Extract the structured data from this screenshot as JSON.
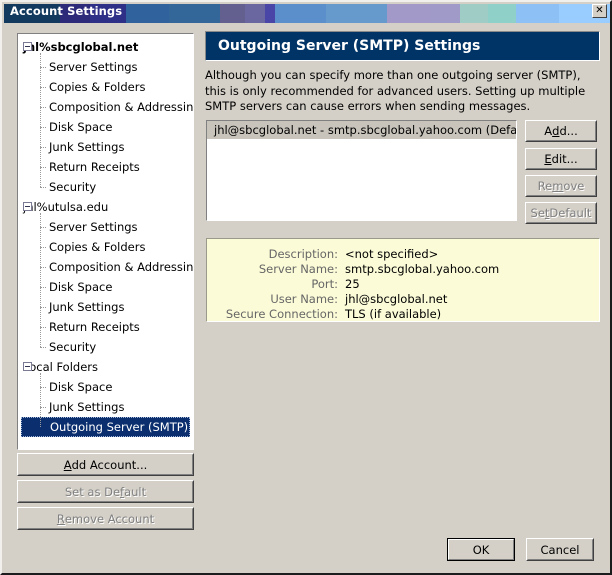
{
  "window": {
    "title": "Account Settings",
    "close_icon": "close-icon",
    "close_glyph": "✕",
    "titlebar_segments": [
      "#123a5e",
      "#2e2a7a",
      "#2e2f86",
      "#30639e",
      "#336699",
      "#635f8f",
      "#6a66a0",
      "#4a46a8",
      "#5b8fcb",
      "#6699cc",
      "#a299c9",
      "#9f9ac8",
      "#9fccc4",
      "#8fd0c8",
      "#8dc0f5",
      "#99ccff"
    ]
  },
  "sidebar": {
    "tree": [
      {
        "label": "jhl%sbcglobal.net",
        "level": 0,
        "bold": true,
        "expanded": true,
        "selected": false
      },
      {
        "label": "Server Settings",
        "level": 1,
        "bold": false,
        "expanded": false,
        "selected": false
      },
      {
        "label": "Copies & Folders",
        "level": 1,
        "bold": false,
        "expanded": false,
        "selected": false
      },
      {
        "label": "Composition & Addressing",
        "level": 1,
        "bold": false,
        "expanded": false,
        "selected": false
      },
      {
        "label": "Disk Space",
        "level": 1,
        "bold": false,
        "expanded": false,
        "selected": false
      },
      {
        "label": "Junk Settings",
        "level": 1,
        "bold": false,
        "expanded": false,
        "selected": false
      },
      {
        "label": "Return Receipts",
        "level": 1,
        "bold": false,
        "expanded": false,
        "selected": false
      },
      {
        "label": "Security",
        "level": 1,
        "bold": false,
        "expanded": false,
        "selected": false
      },
      {
        "label": "jhl%utulsa.edu",
        "level": 0,
        "bold": false,
        "expanded": true,
        "selected": false
      },
      {
        "label": "Server Settings",
        "level": 1,
        "bold": false,
        "expanded": false,
        "selected": false
      },
      {
        "label": "Copies & Folders",
        "level": 1,
        "bold": false,
        "expanded": false,
        "selected": false
      },
      {
        "label": "Composition & Addressing",
        "level": 1,
        "bold": false,
        "expanded": false,
        "selected": false
      },
      {
        "label": "Disk Space",
        "level": 1,
        "bold": false,
        "expanded": false,
        "selected": false
      },
      {
        "label": "Junk Settings",
        "level": 1,
        "bold": false,
        "expanded": false,
        "selected": false
      },
      {
        "label": "Return Receipts",
        "level": 1,
        "bold": false,
        "expanded": false,
        "selected": false
      },
      {
        "label": "Security",
        "level": 1,
        "bold": false,
        "expanded": false,
        "selected": false
      },
      {
        "label": "Local Folders",
        "level": 0,
        "bold": false,
        "expanded": true,
        "selected": false
      },
      {
        "label": "Disk Space",
        "level": 1,
        "bold": false,
        "expanded": false,
        "selected": false
      },
      {
        "label": "Junk Settings",
        "level": 1,
        "bold": false,
        "expanded": false,
        "selected": false
      },
      {
        "label": "Outgoing Server (SMTP)",
        "level": 1,
        "bold": false,
        "expanded": false,
        "selected": true
      }
    ],
    "buttons": [
      {
        "id": "add-account",
        "label": "Add Account...",
        "mnemonic": "A",
        "enabled": true
      },
      {
        "id": "set-as-default",
        "label": "Set as Default",
        "mnemonic": "f",
        "enabled": false
      },
      {
        "id": "remove-account",
        "label": "Remove Account",
        "mnemonic": "R",
        "enabled": false
      }
    ]
  },
  "main": {
    "heading": "Outgoing Server (SMTP) Settings",
    "description": "Although you can specify more than one outgoing server (SMTP), this is only recommended for advanced users. Setting up multiple SMTP servers can cause errors when sending messages.",
    "server_list": [
      {
        "label": "jhl@sbcglobal.net - smtp.sbcglobal.yahoo.com (Default)",
        "selected": true
      }
    ],
    "list_buttons": [
      {
        "id": "add",
        "label": "Add...",
        "mnemonic": "d",
        "enabled": true
      },
      {
        "id": "edit",
        "label": "Edit...",
        "mnemonic": "E",
        "enabled": true
      },
      {
        "id": "remove",
        "label": "Remove",
        "mnemonic": "m",
        "enabled": false
      },
      {
        "id": "set-default",
        "label": "Set Default",
        "mnemonic": "t",
        "enabled": false
      }
    ],
    "details": [
      {
        "label": "Description:",
        "value": "<not specified>"
      },
      {
        "label": "Server Name:",
        "value": "smtp.sbcglobal.yahoo.com"
      },
      {
        "label": "Port:",
        "value": "25"
      },
      {
        "label": "User Name:",
        "value": "jhl@sbcglobal.net"
      },
      {
        "label": "Secure Connection:",
        "value": "TLS (if available)"
      }
    ]
  },
  "footer": {
    "ok_label": "OK",
    "cancel_label": "Cancel"
  },
  "colors": {
    "dialog_face": "#d4d0c8",
    "header_blue": "#003366",
    "selection_blue": "#0b2f6e",
    "details_bg": "#fbfbd8"
  }
}
